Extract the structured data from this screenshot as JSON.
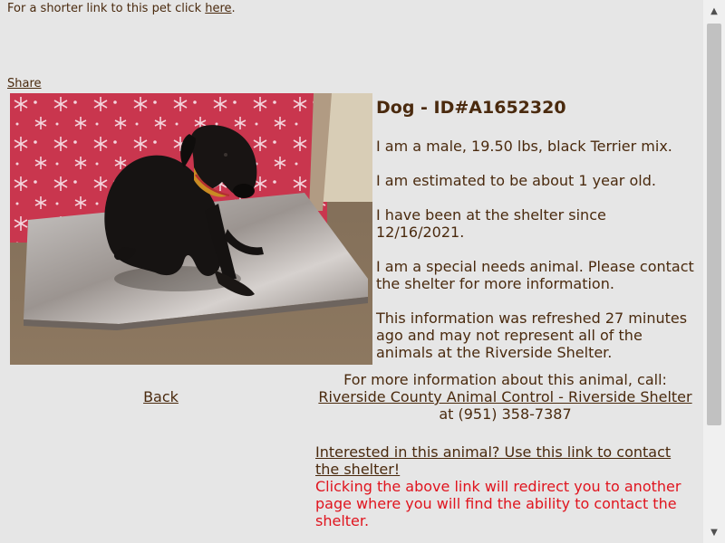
{
  "top_line": {
    "prefix": "For a shorter link to this pet click ",
    "link_text": "here",
    "suffix": "."
  },
  "share_label": "Share",
  "animal": {
    "title": "Dog - ID#A1652320",
    "description": "I am a male, 19.50 lbs, black Terrier mix.",
    "age": "I am estimated to be about 1 year old.",
    "since": "I have been at the shelter since 12/16/2021.",
    "special_needs": "I am a special needs animal. Please contact the shelter for more information.",
    "refresh_note": "This information was refreshed 27 minutes ago and may not represent all of the animals at the Riverside Shelter."
  },
  "back_label": "Back",
  "contact": {
    "intro": "For more information about this animal, call:",
    "shelter_link": "Riverside County Animal Control - Riverside Shelter",
    "phone_text": " at (951) 358-7387"
  },
  "interest": {
    "link_text": "Interested in this animal? Use this link to contact the shelter!",
    "redirect_note": "Clicking the above link will redirect you to another page where you will find the ability to contact the shelter."
  },
  "colors": {
    "background": "#e6e6e6",
    "text": "#4a2a0e",
    "warning": "#e0141e"
  }
}
